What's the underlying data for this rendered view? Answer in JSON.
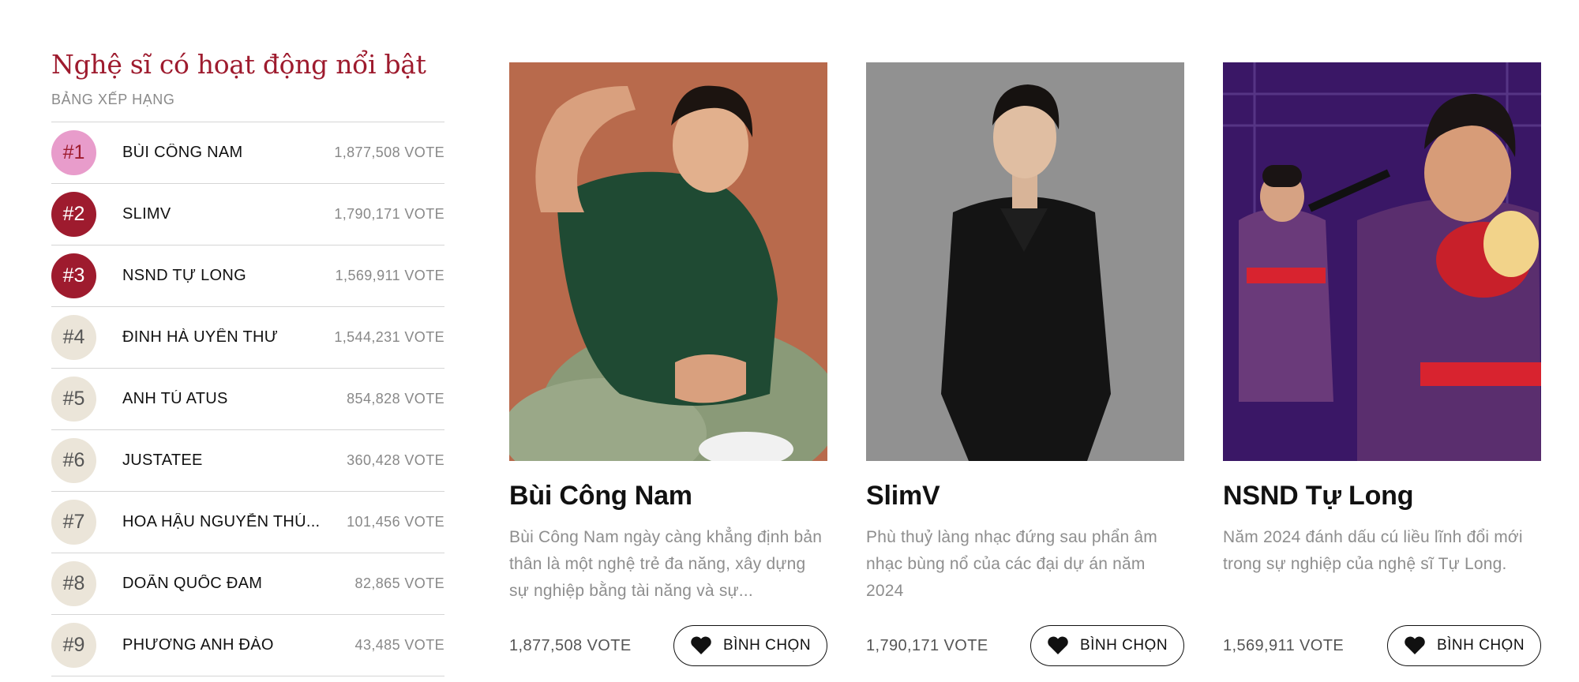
{
  "ranking": {
    "title": "Nghệ sĩ có hoạt động nổi bật",
    "subtitle": "BẢNG XẾP HẠNG",
    "items": [
      {
        "rank": "#1",
        "name": "BÙI CÔNG NAM",
        "votes": "1,877,508 VOTE",
        "badge_bg": "#e89ccb",
        "badge_fg": "#9e1b2e"
      },
      {
        "rank": "#2",
        "name": "SLIMV",
        "votes": "1,790,171 VOTE",
        "badge_bg": "#9e1b2e",
        "badge_fg": "#ffffff"
      },
      {
        "rank": "#3",
        "name": "NSND TỰ LONG",
        "votes": "1,569,911 VOTE",
        "badge_bg": "#9e1b2e",
        "badge_fg": "#ffffff"
      },
      {
        "rank": "#4",
        "name": "ĐINH HÀ UYÊN THƯ",
        "votes": "1,544,231 VOTE",
        "badge_bg": "#ebe5d9",
        "badge_fg": "#555555"
      },
      {
        "rank": "#5",
        "name": "ANH TÚ ATUS",
        "votes": "854,828 VOTE",
        "badge_bg": "#ebe5d9",
        "badge_fg": "#555555"
      },
      {
        "rank": "#6",
        "name": "JUSTATEE",
        "votes": "360,428 VOTE",
        "badge_bg": "#ebe5d9",
        "badge_fg": "#555555"
      },
      {
        "rank": "#7",
        "name": "HOA HẬU NGUYỄN THÚ...",
        "votes": "101,456 VOTE",
        "badge_bg": "#ebe5d9",
        "badge_fg": "#555555"
      },
      {
        "rank": "#8",
        "name": "DOÃN QUỐC ĐAM",
        "votes": "82,865 VOTE",
        "badge_bg": "#ebe5d9",
        "badge_fg": "#555555"
      },
      {
        "rank": "#9",
        "name": "PHƯƠNG ANH ĐÀO",
        "votes": "43,485 VOTE",
        "badge_bg": "#ebe5d9",
        "badge_fg": "#555555"
      }
    ]
  },
  "cards": [
    {
      "name": "Bùi Công Nam",
      "description": "Bùi Công Nam ngày càng khẳng định bản thân là một nghệ trẻ đa năng, xây dựng sự nghiệp bằng tài năng và sự...",
      "votes": "1,877,508 VOTE",
      "button_label": "BÌNH CHỌN",
      "photo_bg": "#b86a4c"
    },
    {
      "name": "SlimV",
      "description": "Phù thuỷ làng nhạc đứng sau phẩn âm nhạc bùng nổ của các đại dự án năm 2024",
      "votes": "1,790,171 VOTE",
      "button_label": "BÌNH CHỌN",
      "photo_bg": "#8c8c8c"
    },
    {
      "name": "NSND Tự Long",
      "description": "Năm 2024 đánh dấu cú liều lĩnh đổi mới trong sự nghiệp của nghệ sĩ Tự Long.",
      "votes": "1,569,911 VOTE",
      "button_label": "BÌNH CHỌN",
      "photo_bg": "#3a1766"
    }
  ],
  "icons": {
    "vote": "heart-icon"
  },
  "colors": {
    "accent": "#9e1b2e",
    "rank1": "#e89ccb",
    "rank_default": "#ebe5d9"
  }
}
